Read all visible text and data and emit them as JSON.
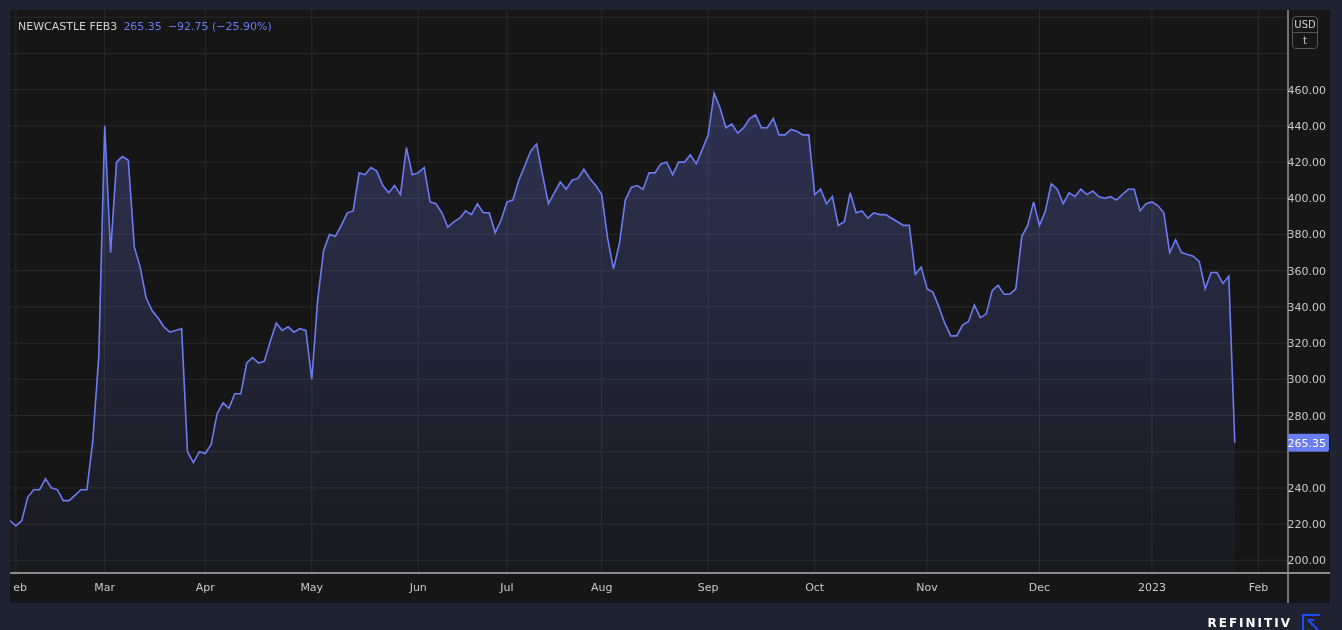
{
  "legend": {
    "price": "265.35",
    "change": "−92.75 (−25.90%)"
  },
  "currency": {
    "unit": "USD",
    "per": "t"
  },
  "last_price_label": "265.35",
  "chart_data": {
    "type": "area",
    "categories": [
      null,
      "eb",
      null,
      null,
      null,
      null,
      null,
      null,
      null,
      null,
      null,
      null,
      null,
      null,
      null,
      null,
      "Mar",
      null,
      null,
      null,
      null,
      null,
      null,
      null,
      null,
      null,
      null,
      null,
      null,
      null,
      null,
      null,
      null,
      "Apr",
      null,
      null,
      null,
      null,
      null,
      null,
      null,
      null,
      null,
      null,
      null,
      null,
      null,
      null,
      null,
      null,
      null,
      "May",
      null,
      null,
      null,
      null,
      null,
      null,
      null,
      null,
      null,
      null,
      null,
      null,
      null,
      null,
      null,
      null,
      null,
      "Jun",
      null,
      null,
      null,
      null,
      null,
      null,
      null,
      null,
      null,
      null,
      null,
      null,
      null,
      null,
      "Jul",
      null,
      null,
      null,
      null,
      null,
      null,
      null,
      null,
      null,
      null,
      null,
      null,
      null,
      null,
      null,
      "Aug",
      null,
      null,
      null,
      null,
      null,
      null,
      null,
      null,
      null,
      null,
      null,
      null,
      null,
      null,
      null,
      null,
      null,
      "Sep",
      null,
      null,
      null,
      null,
      null,
      null,
      null,
      null,
      null,
      null,
      null,
      null,
      null,
      null,
      null,
      null,
      null,
      "Oct",
      null,
      null,
      null,
      null,
      null,
      null,
      null,
      null,
      null,
      null,
      null,
      null,
      null,
      null,
      null,
      null,
      null,
      null,
      "Nov",
      null,
      null,
      null,
      null,
      null,
      null,
      null,
      null,
      null,
      null,
      null,
      null,
      null,
      null,
      null,
      null,
      null,
      null,
      "Dec",
      null,
      null,
      null,
      null,
      null,
      null,
      null,
      null,
      null,
      null,
      null,
      null,
      null,
      null,
      null,
      null,
      null,
      null,
      "2023",
      null,
      null,
      null,
      null,
      null,
      null,
      null,
      null,
      null,
      null,
      null,
      null,
      null,
      null,
      null,
      null,
      null,
      "Feb",
      null,
      null,
      null,
      null,
      null
    ],
    "series": [
      {
        "name": "NEWCASTLE FEB3",
        "color": "#6b7cf2",
        "values": [
          222,
          219,
          222,
          235,
          239,
          239,
          245,
          240,
          239,
          233,
          233,
          236,
          239,
          239,
          266,
          313,
          440,
          370,
          420,
          423,
          421,
          373,
          362,
          345,
          338,
          334,
          329,
          326,
          327,
          328,
          260,
          254,
          260,
          259,
          264,
          281,
          287,
          284,
          292,
          292,
          309,
          312,
          309,
          310,
          321,
          331,
          327,
          329,
          326,
          328,
          327,
          300,
          344,
          371,
          380,
          379,
          385,
          392,
          393,
          414,
          413,
          417,
          415,
          407,
          403,
          407,
          402,
          428,
          413,
          414,
          417,
          398,
          397,
          392,
          384,
          387,
          389,
          393,
          391,
          397,
          392,
          392,
          381,
          388,
          398,
          399,
          410,
          418,
          426,
          430,
          413,
          397,
          403,
          409,
          405,
          410,
          411,
          416,
          411,
          407,
          402,
          378,
          361,
          375,
          399,
          406,
          407,
          405,
          414,
          414,
          419,
          420,
          413,
          420,
          420,
          424,
          419,
          427,
          435,
          458,
          450,
          439,
          441,
          436,
          439,
          444,
          446,
          439,
          439,
          444,
          435,
          435,
          438,
          437,
          435,
          435,
          402,
          405,
          397,
          401,
          385,
          387,
          403,
          392,
          393,
          389,
          392,
          391,
          391,
          389,
          387,
          385,
          385,
          358,
          362,
          350,
          348,
          340,
          331,
          324,
          324,
          330,
          332,
          341,
          334,
          336,
          349,
          352,
          347,
          347,
          350,
          379,
          385,
          398,
          385,
          393,
          408,
          405,
          397,
          403,
          401,
          405,
          402,
          404,
          401,
          400,
          401,
          399,
          402,
          405,
          405,
          393,
          397,
          398,
          396,
          392,
          370,
          377,
          370,
          369,
          368,
          365,
          350,
          359,
          359,
          353,
          357,
          265,
          null,
          null,
          null,
          null,
          null,
          null,
          null,
          null,
          null
        ]
      }
    ],
    "grid": true,
    "ylim": [
      193,
      504
    ],
    "yticks": [
      {
        "value": 200,
        "label": "200.00"
      },
      {
        "value": 220,
        "label": "220.00"
      },
      {
        "value": 240,
        "label": "240.00"
      },
      {
        "value": 280,
        "label": "280.00"
      },
      {
        "value": 300,
        "label": "300.00"
      },
      {
        "value": 320,
        "label": "320.00"
      },
      {
        "value": 340,
        "label": "340.00"
      },
      {
        "value": 360,
        "label": "360.00"
      },
      {
        "value": 380,
        "label": "380.00"
      },
      {
        "value": 400,
        "label": "400.00"
      },
      {
        "value": 420,
        "label": "420.00"
      },
      {
        "value": 440,
        "label": "440.00"
      },
      {
        "value": 460,
        "label": "460.00"
      }
    ]
  },
  "footer": {
    "brand": "REFINITIV"
  }
}
